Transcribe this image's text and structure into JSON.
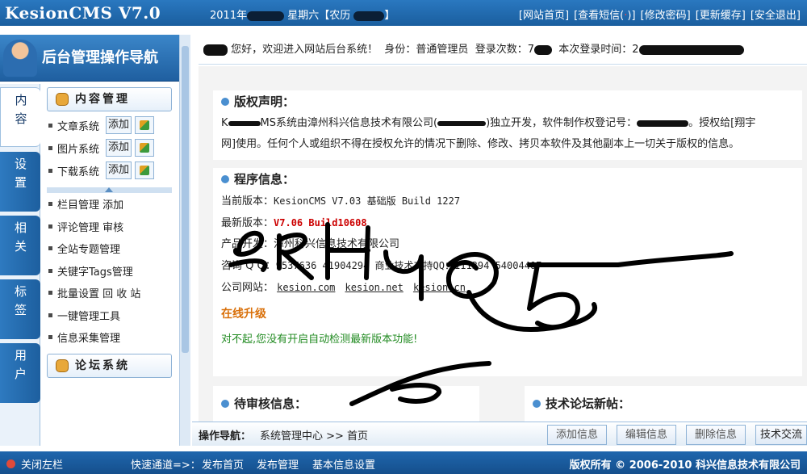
{
  "header": {
    "brand": "KesionCMS V7.0",
    "date_prefix": "2011年",
    "weekday": "星期六【农历",
    "date_suffix": "】",
    "links": [
      "[网站首页]",
      "[查看短信(",
      ")]",
      "[修改密码]",
      "[更新缓存]",
      "[安全退出]"
    ]
  },
  "nav": {
    "title": "后台管理操作导航",
    "tabs": [
      "内容",
      "设置",
      "相关",
      "标签",
      "用户"
    ],
    "content_group": "内容管理",
    "systems": [
      {
        "label": "文章系统",
        "add": "添加"
      },
      {
        "label": "图片系统",
        "add": "添加"
      },
      {
        "label": "下载系统",
        "add": "添加"
      }
    ],
    "menu": [
      "栏目管理 添加",
      "评论管理 审核",
      "全站专题管理",
      "关键字Tags管理",
      "批量设置 回 收 站",
      "一键管理工具",
      "信息采集管理"
    ],
    "forum_group": "论坛系统"
  },
  "welcome": {
    "greeting": "您好，欢迎进入网站后台系统！",
    "role": "身份：普通管理员",
    "login_count": "登录次数：",
    "count_value": "7",
    "login_time": "本次登录时间：",
    "time_value": "2"
  },
  "copyright": {
    "title": "版权声明：",
    "text1": "系统由漳州科兴信息技术有限公司(",
    "text2": ")独立开发，软件制作权登记号：",
    "text3": "。授权给[翔宇",
    "text4": "网]使用。任何个人或组织不得在授权允许的情况下删除、修改、拷贝本软件及其他副本上一切关于版权的信息。"
  },
  "program": {
    "title": "程序信息：",
    "version_label": "当前版本：",
    "version": "KesionCMS V7.03 基础版 Build 1227",
    "latest_label": "最新版本：",
    "latest": "V7.06 Build10608",
    "dev_label": "产品开发：",
    "dev": "漳州科兴信息技术有限公司",
    "qq_label": "咨询 Q Q：",
    "qq": "9537636 41904294 商业技术支持QQ：111394 54004407",
    "site_label": "公司网站：",
    "sites": [
      "kesion.com",
      "kesion.net",
      "kesion.cn"
    ],
    "upgrade": "在线升级",
    "notice": "对不起,您没有开启自动检测最新版本功能!"
  },
  "bottom_sections": {
    "pending": "待审核信息：",
    "forum": "技术论坛新帖："
  },
  "opbar": {
    "label": "操作导航：",
    "path": "系统管理中心 >> 首页",
    "buttons": [
      "添加信息",
      "编辑信息",
      "删除信息",
      "技术交流"
    ]
  },
  "footer": {
    "close": "关闭左栏",
    "quick": "快速通道=>：",
    "links": [
      "发布首页",
      "发布管理",
      "基本信息设置"
    ],
    "copyright": "版权所有 © 2006-2010 科兴信息技术有限公司"
  },
  "colors": {
    "header_blue": "#1a5e9e",
    "upgrade_orange": "#d9700a",
    "notice_green": "#228b22"
  }
}
